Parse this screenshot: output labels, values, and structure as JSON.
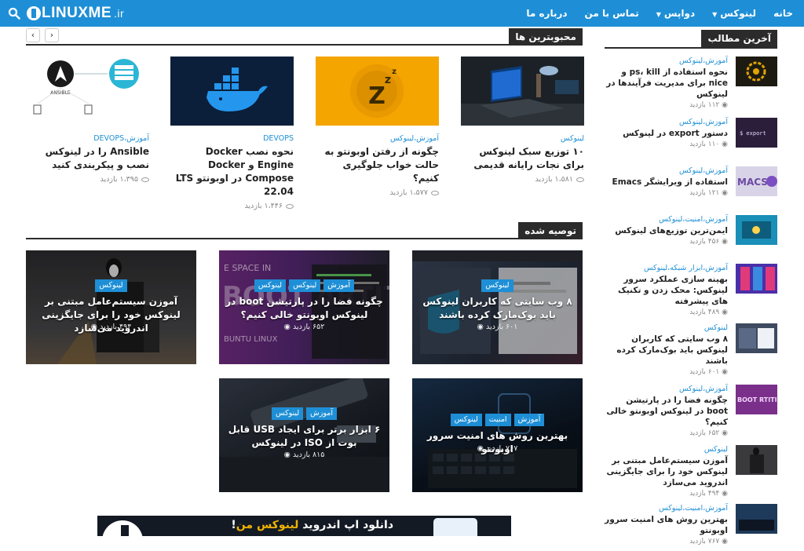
{
  "header": {
    "logo_text": "LINUXME",
    "logo_suffix": ".ir",
    "nav": [
      "خانه",
      "لینوکس",
      "دواپس",
      "تماس با من",
      "درباره ما"
    ],
    "accent": "#1e8fd6"
  },
  "icons": {
    "search": "search-icon",
    "eye": "eye-icon",
    "prev": "chevron-left-icon",
    "next": "chevron-right-icon"
  },
  "popular": {
    "heading": "محبوبترین ها",
    "prev_label": "‹",
    "next_label": "›",
    "cards": [
      {
        "category": "لینوکس",
        "title": "۱۰ توزیع سبک لینوکس برای نجات رایانه قدیمی",
        "views": "۱،۵۸۱ بازدید"
      },
      {
        "category": "آموزش،لینوکس",
        "title": "چگونه از رفتن اوبونتو به حالت خواب جلوگیری کنیم؟",
        "views": "۱،۵۷۷ بازدید"
      },
      {
        "category": "DEVOPS",
        "title": "نحوه نصب Docker Engine و Docker Compose در اوبونتو LTS 22.04",
        "views": "۱،۴۴۶ بازدید"
      },
      {
        "category": "آموزش،DEVOPS",
        "title": "Ansible را در لینوکس نصب و پیکربندی کنید",
        "views": "۱،۳۹۵ بازدید"
      }
    ],
    "ansible_caption": "ANSIBLE",
    "docker_caption": "",
    "sleep_caption": "Z Z Z"
  },
  "recommended": {
    "heading": "توصیه شده",
    "tiles": [
      {
        "tags": [
          "لینوکس"
        ],
        "title": "۸ وب سایتی که کاربران لینوکس باید بوک‌مارک کرده باشند",
        "views": "۶۰۱ بازدید"
      },
      {
        "tags": [
          "آموزش",
          "لینوکس",
          "لینوکس"
        ],
        "title": "چگونه فضا را در پارتیشن boot در لینوکس اوبونتو خالی کنیم؟",
        "views": "۶۵۲ بازدید"
      },
      {
        "tags": [
          "لینوکس"
        ],
        "title": "آموزن سیستم‌عامل مبتنی بر لینوکس خود را برای جایگزینی اندروید می‌سازد",
        "views": "۴۹۴ بازدید"
      },
      {
        "tags": [
          "آموزش",
          "امنیت",
          "لینوکس"
        ],
        "title": "بهترین روش های امنیت سرور اوبونتو",
        "views": "۷۶۷ بازدید"
      },
      {
        "tags": [
          "آموزش",
          "لینوکس"
        ],
        "title": "۶ ابزار برتر برای ایجاد USB قابل بوت از ISO در لینوکس",
        "views": "۸۱۵ بازدید"
      }
    ],
    "boot_text": "BOOT ARTITION",
    "boot_sub": "BUNTU LINUX",
    "boot_space": "E SPACE IN"
  },
  "sidebar": {
    "heading": "آخرین مطالب",
    "items": [
      {
        "category": "آموزش،لینوکس",
        "title": "نحوه استفاده از ps، kill و nice برای مدیریت فرآیندها در لینوکس",
        "views": "۱۱۲ بازدید"
      },
      {
        "category": "آموزش،لینوکس",
        "title": "دستور export در لینوکس",
        "views": "۱۱۰ بازدید"
      },
      {
        "category": "آموزش،لینوکس",
        "title": "استفاده از ویرایشگر Emacs",
        "views": "۱۲۱ بازدید"
      },
      {
        "category": "آموزش،امنیت،لینوکس",
        "title": "ایمن‌ترین توزیع‌های لینوکس",
        "views": "۴۵۶ بازدید"
      },
      {
        "category": "آموزش،ابزار شبکه،لینوکس",
        "title": "بهینه سازی عملکرد سرور لینوکس: محک زدن و تکنیک های پیشرفته",
        "views": "۴۸۹ بازدید"
      },
      {
        "category": "لینوکس",
        "title": "۸ وب سایتی که کاربران لینوکس باید بوک‌مارک کرده باشند",
        "views": "۶۰۱ بازدید"
      },
      {
        "category": "آموزش،لینوکس",
        "title": "چگونه فضا را در پارتیشن boot در لینوکس اوبونتو خالی کنیم؟",
        "views": "۶۵۲ بازدید"
      },
      {
        "category": "لینوکس",
        "title": "آموزن سیستم‌عامل مبتنی بر لینوکس خود را برای جایگزینی اندروید می‌سازد",
        "views": "۴۹۴ بازدید"
      },
      {
        "category": "آموزش،امنیت،لینوکس",
        "title": "بهترین روش های امنیت سرور اوبونتو",
        "views": "۷۶۷ بازدید"
      }
    ],
    "emacs_text": "MACS",
    "export_text": "$ export",
    "boot_text": "BOOT RTITION"
  },
  "banner": {
    "text_prefix": "دانلود اپ اندروید",
    "text_highlight": "لینوکس من",
    "text_suffix": "!"
  }
}
